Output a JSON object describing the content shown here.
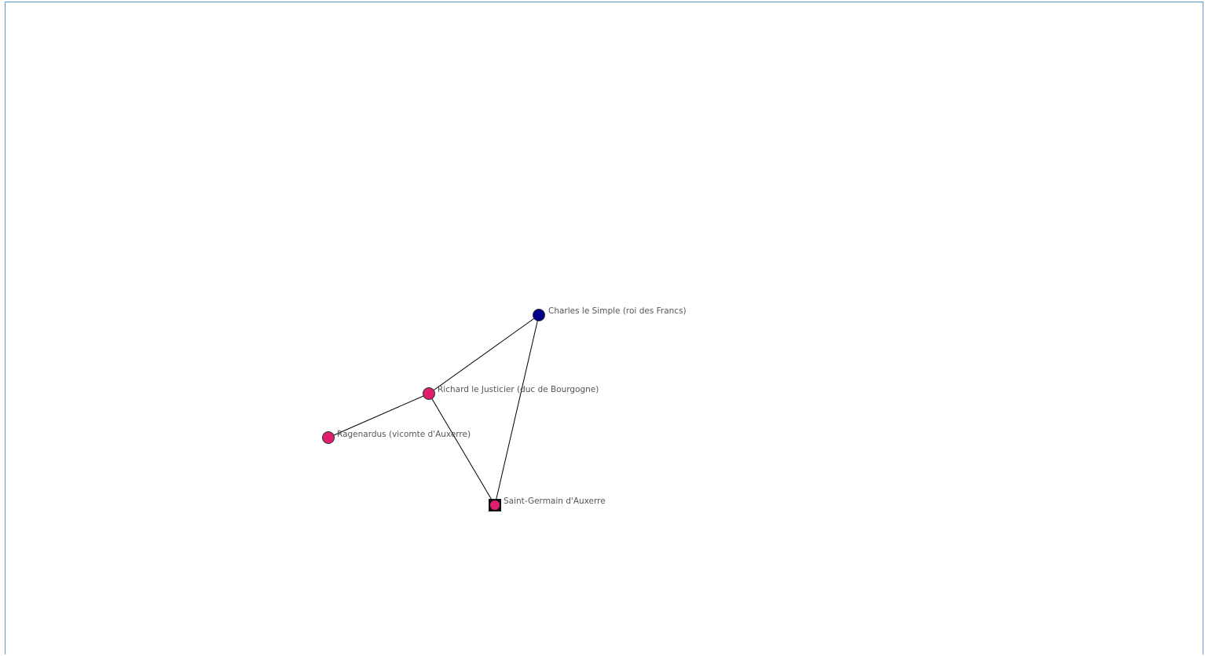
{
  "graph": {
    "nodes": [
      {
        "id": "charles",
        "label": "Charles le Simple (roi des Francs)",
        "shape": "circle",
        "color": "#00008b"
      },
      {
        "id": "richard",
        "label": "Richard le Justicier (duc de Bourgogne)",
        "shape": "circle",
        "color": "#dd1f6e"
      },
      {
        "id": "ragenardus",
        "label": "Ragenardus (vicomte d'Auxerre)",
        "shape": "circle",
        "color": "#dd1f6e"
      },
      {
        "id": "saint-germain",
        "label": "Saint-Germain d'Auxerre",
        "shape": "square-circle",
        "color": "#dd1f6e"
      }
    ],
    "edges": [
      {
        "from": "charles",
        "to": "richard"
      },
      {
        "from": "charles",
        "to": "saint-germain"
      },
      {
        "from": "richard",
        "to": "ragenardus"
      },
      {
        "from": "richard",
        "to": "saint-germain"
      }
    ]
  }
}
